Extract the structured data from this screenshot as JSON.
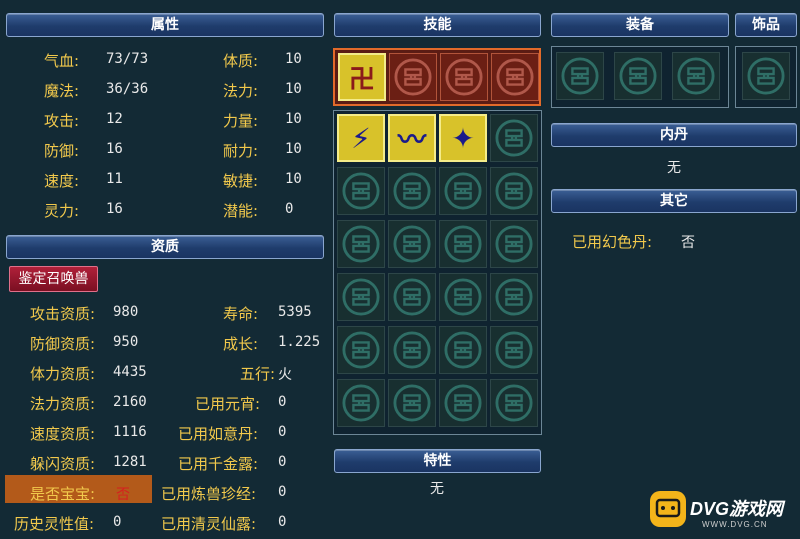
{
  "headers": {
    "attributes": "属性",
    "skills": "技能",
    "equipment": "装备",
    "accessory": "饰品",
    "aptitude": "资质",
    "neidan": "内丹",
    "other": "其它",
    "traits": "特性"
  },
  "attributes_left": [
    {
      "label": "气血:",
      "value": "73/73"
    },
    {
      "label": "魔法:",
      "value": "36/36"
    },
    {
      "label": "攻击:",
      "value": "12"
    },
    {
      "label": "防御:",
      "value": "16"
    },
    {
      "label": "速度:",
      "value": "11"
    },
    {
      "label": "灵力:",
      "value": "16"
    }
  ],
  "attributes_right": [
    {
      "label": "体质:",
      "value": "10"
    },
    {
      "label": "法力:",
      "value": "10"
    },
    {
      "label": "力量:",
      "value": "10"
    },
    {
      "label": "耐力:",
      "value": "10"
    },
    {
      "label": "敏捷:",
      "value": "10"
    },
    {
      "label": "潜能:",
      "value": "0"
    }
  ],
  "identify_button": "鉴定召唤兽",
  "aptitude_left": [
    {
      "label": "攻击资质:",
      "value": "980"
    },
    {
      "label": "防御资质:",
      "value": "950"
    },
    {
      "label": "体力资质:",
      "value": "4435"
    },
    {
      "label": "法力资质:",
      "value": "2160"
    },
    {
      "label": "速度资质:",
      "value": "1116"
    },
    {
      "label": "躲闪资质:",
      "value": "1281"
    },
    {
      "label": "是否宝宝:",
      "value": "否"
    },
    {
      "label": "历史灵性值:",
      "value": "0"
    }
  ],
  "aptitude_right": [
    {
      "label": "寿命:",
      "value": "5395"
    },
    {
      "label": "成长:",
      "value": "1.225"
    },
    {
      "label": "五行:",
      "value": "火"
    },
    {
      "label": "已用元宵:",
      "value": "0"
    },
    {
      "label": "已用如意丹:",
      "value": "0"
    },
    {
      "label": "已用千金露:",
      "value": "0"
    },
    {
      "label": "已用炼兽珍经:",
      "value": "0"
    },
    {
      "label": "已用清灵仙露:",
      "value": "0"
    }
  ],
  "neidan_value": "无",
  "other_label": "已用幻色丹:",
  "other_value": "否",
  "traits_value": "无",
  "logo": {
    "brand": "DVG游戏网",
    "url": "WWW.DVG.CN"
  },
  "colors": {
    "label": "#f2c94c",
    "header": "#1f3c6c",
    "highlight": "#b35a1a",
    "no_value": "#d61f1f"
  }
}
